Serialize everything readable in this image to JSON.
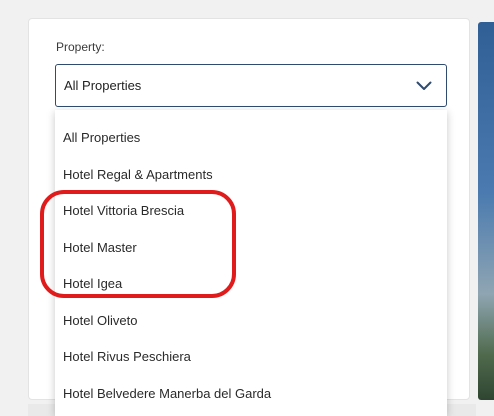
{
  "property_filter": {
    "label": "Property:",
    "selected_value": "All Properties",
    "options": [
      "All Properties",
      "Hotel Regal & Apartments",
      "Hotel Vittoria Brescia",
      "Hotel Master",
      "Hotel Igea",
      "Hotel Oliveto",
      "Hotel Rivus Peschiera",
      "Hotel Belvedere Manerba del Garda"
    ]
  },
  "colors": {
    "select_border": "#2f4b6e",
    "annotation": "#e01b1b"
  },
  "icons": {
    "dropdown_toggle": "chevron-down-icon"
  }
}
